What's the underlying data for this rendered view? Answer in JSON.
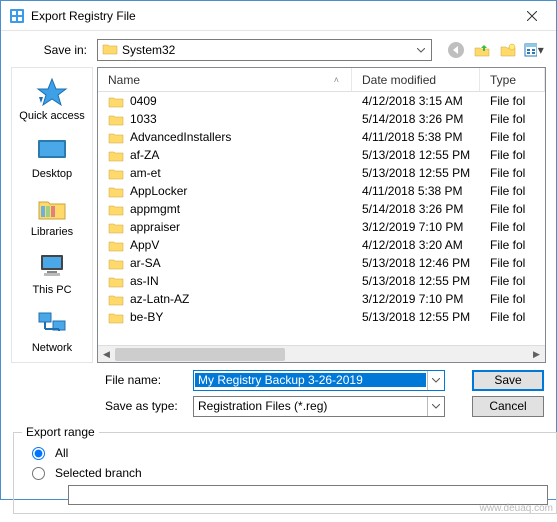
{
  "window": {
    "title": "Export Registry File"
  },
  "savein": {
    "label": "Save in:",
    "value": "System32"
  },
  "toolbar": {
    "back": "back-icon",
    "up": "up-one-level-icon",
    "newfolder": "create-new-folder-icon",
    "view": "view-menu-icon"
  },
  "columns": {
    "name": "Name",
    "date": "Date modified",
    "type": "Type"
  },
  "places": [
    {
      "id": "quickaccess",
      "label": "Quick access"
    },
    {
      "id": "desktop",
      "label": "Desktop"
    },
    {
      "id": "libraries",
      "label": "Libraries"
    },
    {
      "id": "thispc",
      "label": "This PC"
    },
    {
      "id": "network",
      "label": "Network"
    }
  ],
  "files": [
    {
      "name": "0409",
      "date": "4/12/2018 3:15 AM",
      "type": "File fol"
    },
    {
      "name": "1033",
      "date": "5/14/2018 3:26 PM",
      "type": "File fol"
    },
    {
      "name": "AdvancedInstallers",
      "date": "4/11/2018 5:38 PM",
      "type": "File fol"
    },
    {
      "name": "af-ZA",
      "date": "5/13/2018 12:55 PM",
      "type": "File fol"
    },
    {
      "name": "am-et",
      "date": "5/13/2018 12:55 PM",
      "type": "File fol"
    },
    {
      "name": "AppLocker",
      "date": "4/11/2018 5:38 PM",
      "type": "File fol"
    },
    {
      "name": "appmgmt",
      "date": "5/14/2018 3:26 PM",
      "type": "File fol"
    },
    {
      "name": "appraiser",
      "date": "3/12/2019 7:10 PM",
      "type": "File fol"
    },
    {
      "name": "AppV",
      "date": "4/12/2018 3:20 AM",
      "type": "File fol"
    },
    {
      "name": "ar-SA",
      "date": "5/13/2018 12:46 PM",
      "type": "File fol"
    },
    {
      "name": "as-IN",
      "date": "5/13/2018 12:55 PM",
      "type": "File fol"
    },
    {
      "name": "az-Latn-AZ",
      "date": "3/12/2019 7:10 PM",
      "type": "File fol"
    },
    {
      "name": "be-BY",
      "date": "5/13/2018 12:55 PM",
      "type": "File fol"
    }
  ],
  "filename": {
    "label": "File name:",
    "value": "My Registry Backup 3-26-2019"
  },
  "savetype": {
    "label": "Save as type:",
    "value": "Registration Files (*.reg)"
  },
  "buttons": {
    "save": "Save",
    "cancel": "Cancel"
  },
  "export_range": {
    "legend": "Export range",
    "all": "All",
    "selected": "Selected branch",
    "selection": "all",
    "branch_value": ""
  },
  "watermark": "www.deuaq.com"
}
